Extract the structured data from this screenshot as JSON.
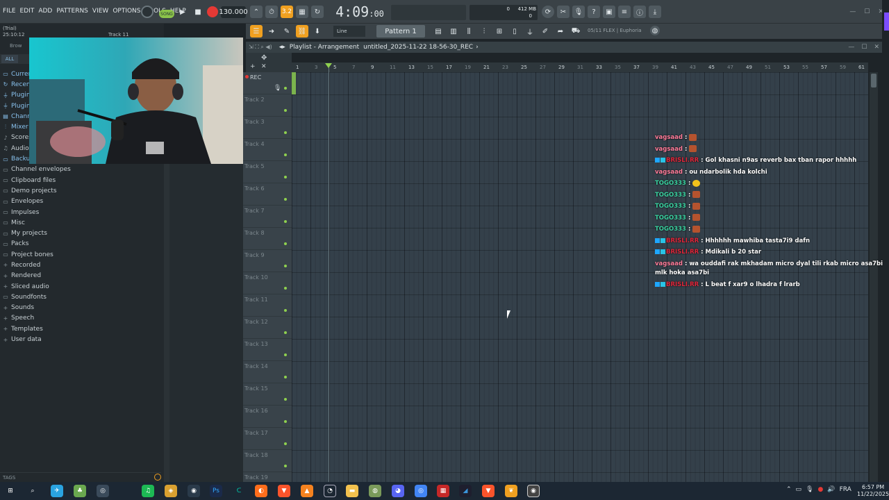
{
  "menu": [
    "FILE",
    "EDIT",
    "ADD",
    "PATTERNS",
    "VIEW",
    "OPTIONS",
    "TOOLS",
    "HELP"
  ],
  "transport": {
    "song_label": "SONG",
    "tempo": "130.000",
    "time": "4:09",
    "time_frac": ":00",
    "cpu": "0",
    "mem": "412 MB",
    "voices": "0"
  },
  "toolbar2": {
    "snap": "Line",
    "pattern": "Pattern 1",
    "plugin_hint": "05/11 FLEX | Euphoria"
  },
  "status": {
    "trial": "(Trial)",
    "elapsed": "25:10:12",
    "track_hint": "Track 11",
    "browser_label": "Brow"
  },
  "browser": {
    "all_tab": "ALL",
    "items": [
      {
        "label": "Curren",
        "icon": "folder",
        "hl": true
      },
      {
        "label": "Recent",
        "icon": "refresh",
        "hl": true
      },
      {
        "label": "Plugin",
        "icon": "plug",
        "hl": true
      },
      {
        "label": "Plugin",
        "icon": "plug",
        "hl": true
      },
      {
        "label": "Chann",
        "icon": "channel",
        "hl": true
      },
      {
        "label": "Mixer",
        "icon": "mixer",
        "hl": true
      },
      {
        "label": "Scores",
        "icon": "score",
        "hl": false
      },
      {
        "label": "Audio",
        "icon": "audio",
        "hl": false
      },
      {
        "label": "Backup",
        "icon": "folder",
        "hl": true
      },
      {
        "label": "Channel envelopes",
        "icon": "folder",
        "hl": false
      },
      {
        "label": "Clipboard files",
        "icon": "folder",
        "hl": false
      },
      {
        "label": "Demo projects",
        "icon": "folder",
        "hl": false
      },
      {
        "label": "Envelopes",
        "icon": "folder",
        "hl": false
      },
      {
        "label": "Impulses",
        "icon": "folder",
        "hl": false
      },
      {
        "label": "Misc",
        "icon": "folder",
        "hl": false
      },
      {
        "label": "My projects",
        "icon": "folder",
        "hl": false
      },
      {
        "label": "Packs",
        "icon": "folder",
        "hl": false
      },
      {
        "label": "Project bones",
        "icon": "folder",
        "hl": false
      },
      {
        "label": "Recorded",
        "icon": "plus",
        "hl": false
      },
      {
        "label": "Rendered",
        "icon": "plus",
        "hl": false
      },
      {
        "label": "Sliced audio",
        "icon": "plus",
        "hl": false
      },
      {
        "label": "Soundfonts",
        "icon": "folder",
        "hl": false
      },
      {
        "label": "Sounds",
        "icon": "plus",
        "hl": false
      },
      {
        "label": "Speech",
        "icon": "plus",
        "hl": false
      },
      {
        "label": "Templates",
        "icon": "plus",
        "hl": false
      },
      {
        "label": "User data",
        "icon": "plus",
        "hl": false
      }
    ],
    "tags_label": "TAGS"
  },
  "playlist": {
    "title": "Playlist - Arrangement",
    "project": "untitled_2025-11-22 18-56-30_REC",
    "rec_label": "REC",
    "ruler": [
      "1",
      "3",
      "5",
      "7",
      "9",
      "11",
      "13",
      "15",
      "17",
      "19",
      "21",
      "23",
      "25",
      "27",
      "29",
      "31",
      "33",
      "35",
      "37",
      "39",
      "41",
      "43",
      "45",
      "47",
      "49",
      "51",
      "53",
      "55",
      "57",
      "59",
      "61"
    ],
    "tracks": [
      "",
      "Track 2",
      "Track 3",
      "Track 4",
      "Track 5",
      "Track 6",
      "Track 7",
      "Track 8",
      "Track 9",
      "Track 10",
      "Track 11",
      "Track 12",
      "Track 13",
      "Track 14",
      "Track 15",
      "Track 16",
      "Track 17",
      "Track 18",
      "Track 19"
    ]
  },
  "chat": [
    {
      "user": "vagsaad",
      "color": "pink",
      "badges": 0,
      "text": "",
      "emote": "face"
    },
    {
      "user": "vagsaad",
      "color": "pink",
      "badges": 0,
      "text": "",
      "emote": "face"
    },
    {
      "user": "BRISLI.RR",
      "color": "red",
      "badges": 2,
      "text": "Gol khasni n9as reverb bax tban rapor hhhhh",
      "emote": ""
    },
    {
      "user": "vagsaad",
      "color": "pink",
      "badges": 0,
      "text": "ou ndarbolik hda kolchi",
      "emote": ""
    },
    {
      "user": "TOGO333",
      "color": "teal",
      "badges": 0,
      "text": "",
      "emote": "yellow"
    },
    {
      "user": "TOGO333",
      "color": "teal",
      "badges": 0,
      "text": "",
      "emote": "face"
    },
    {
      "user": "TOGO333",
      "color": "teal",
      "badges": 0,
      "text": "",
      "emote": "face"
    },
    {
      "user": "TOGO333",
      "color": "teal",
      "badges": 0,
      "text": "",
      "emote": "face"
    },
    {
      "user": "TOGO333",
      "color": "teal",
      "badges": 0,
      "text": "",
      "emote": "face"
    },
    {
      "user": "BRISLI.RR",
      "color": "red",
      "badges": 2,
      "text": "Hhhhhh mawhiba tasta7i9 dafn",
      "emote": ""
    },
    {
      "user": "BRISLI.RR",
      "color": "red",
      "badges": 2,
      "text": "Mdikali b 20 star",
      "emote": ""
    },
    {
      "user": "vagsaad",
      "color": "pink",
      "badges": 0,
      "text": "wa ouddafi rak mkhadam micro dyal tili rkab micro asa7bi mlk hoka asa7bi",
      "emote": "",
      "wrap": true
    },
    {
      "user": "BRISLI.RR",
      "color": "red",
      "badges": 2,
      "text": "L beat f xar9 o lhadra f lrarb",
      "emote": ""
    }
  ],
  "taskbar": {
    "lang": "FRA",
    "time": "6:57 PM",
    "date": "11/22/2025"
  },
  "colors": {
    "accent_green": "#8fd14f",
    "accent_orange": "#f0a020",
    "grid_bg": "#34404a",
    "chat_pink": "#ff7c9a",
    "chat_teal": "#3ad1a0",
    "chat_red": "#e0263a"
  }
}
